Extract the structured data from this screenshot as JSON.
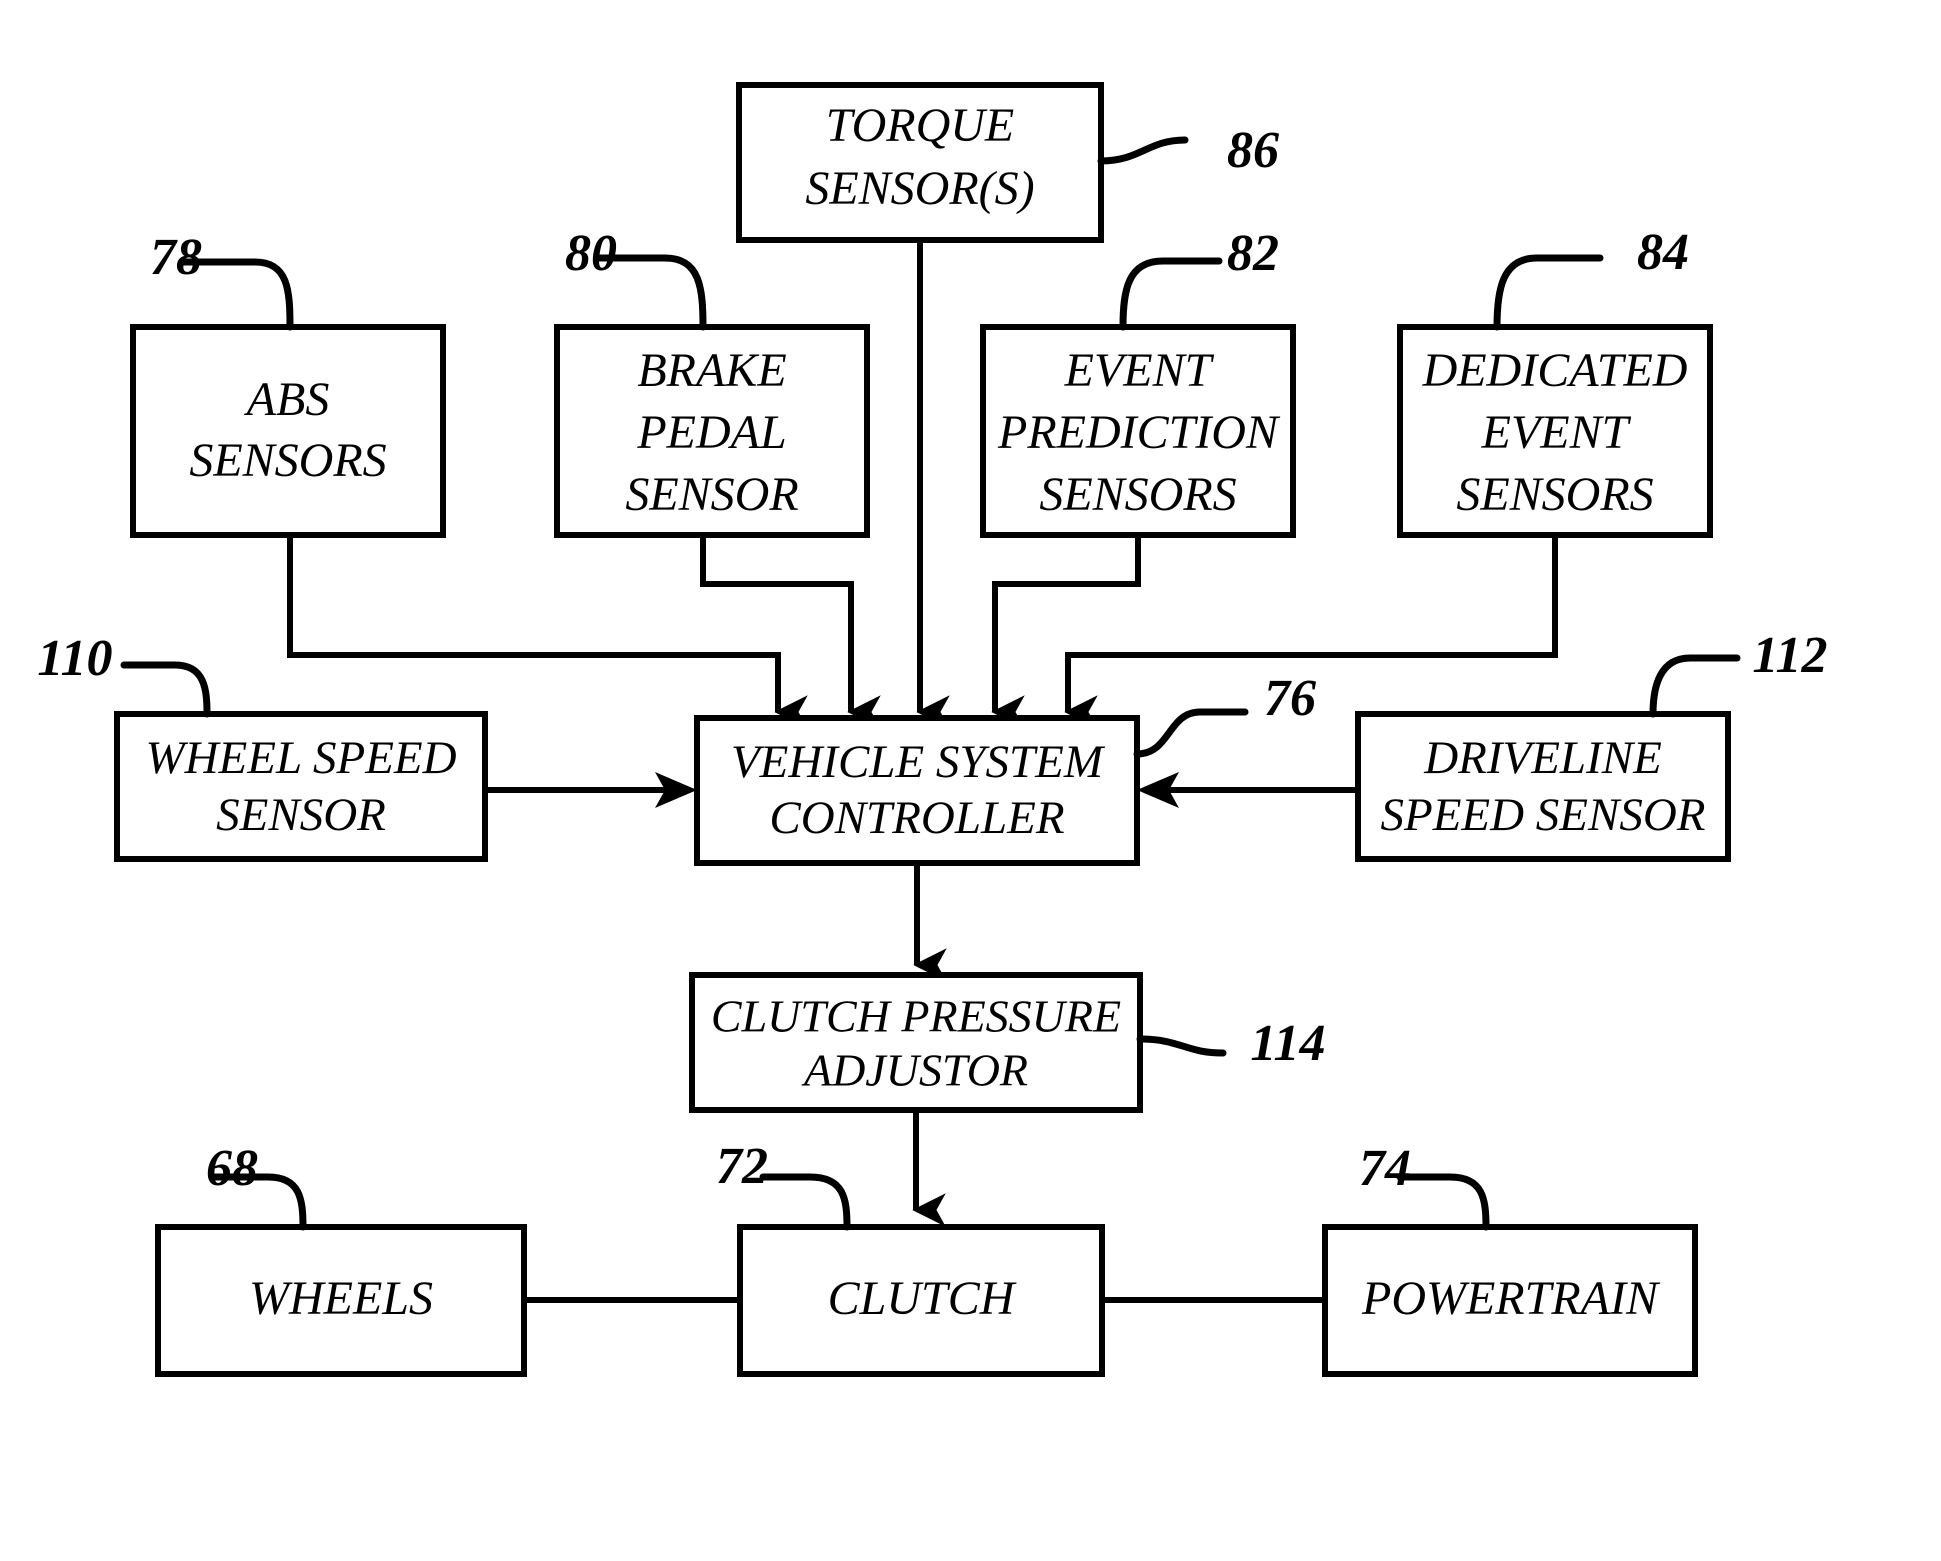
{
  "figure": {
    "type": "patent-block-diagram",
    "background_color": "#ffffff",
    "line_color": "#000000"
  },
  "boxes": {
    "torque_sensors": {
      "label_line1": "TORQUE",
      "label_line2": "SENSOR(S)",
      "ref": "86"
    },
    "abs_sensors": {
      "label_line1": "ABS",
      "label_line2": "SENSORS",
      "ref": "78"
    },
    "brake_pedal_sensor": {
      "label_line1": "BRAKE",
      "label_line2": "PEDAL",
      "label_line3": "SENSOR",
      "ref": "80"
    },
    "event_prediction_sensors": {
      "label_line1": "EVENT",
      "label_line2": "PREDICTION",
      "label_line3": "SENSORS",
      "ref": "82"
    },
    "dedicated_event_sensors": {
      "label_line1": "DEDICATED",
      "label_line2": "EVENT",
      "label_line3": "SENSORS",
      "ref": "84"
    },
    "wheel_speed_sensor": {
      "label_line1": "WHEEL SPEED",
      "label_line2": "SENSOR",
      "ref": "110"
    },
    "vehicle_system_controller": {
      "label_line1": "VEHICLE SYSTEM",
      "label_line2": "CONTROLLER",
      "ref": "76"
    },
    "driveline_speed_sensor": {
      "label_line1": "DRIVELINE",
      "label_line2": "SPEED SENSOR",
      "ref": "112"
    },
    "clutch_pressure_adjustor": {
      "label_line1": "CLUTCH PRESSURE",
      "label_line2": "ADJUSTOR",
      "ref": "114"
    },
    "wheels": {
      "label_line1": "WHEELS",
      "ref": "68"
    },
    "clutch": {
      "label_line1": "CLUTCH",
      "ref": "72"
    },
    "powertrain": {
      "label_line1": "POWERTRAIN",
      "ref": "74"
    }
  },
  "reference_numerals": [
    "86",
    "78",
    "80",
    "82",
    "84",
    "110",
    "76",
    "112",
    "114",
    "68",
    "72",
    "74"
  ]
}
